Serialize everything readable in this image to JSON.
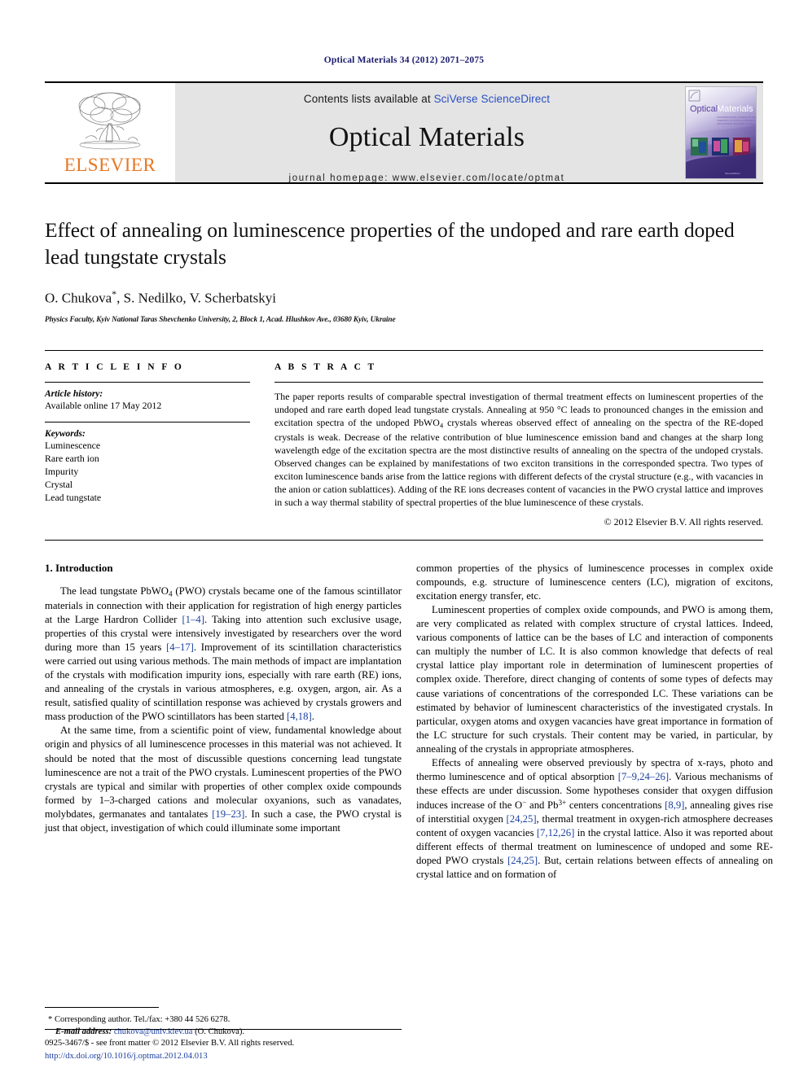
{
  "running_head": "Optical Materials 34 (2012) 2071–2075",
  "masthead": {
    "publisher_name": "ELSEVIER",
    "contents_prefix": "Contents lists available at ",
    "sciencedirect_link": "SciVerse ScienceDirect",
    "journal_title": "Optical Materials",
    "journal_homepage": "journal homepage: www.elsevier.com/locate/optmat",
    "cover_title_part1": "Optical",
    "cover_title_part2": "Materials",
    "cover_subtitle": "AN INTERNATIONAL JOURNAL ON THE PHYSICS AND CHEMISTRY OF OPTICAL MATERIALS AND THEIR APPLICATIONS"
  },
  "article": {
    "title": "Effect of annealing on luminescence properties of the undoped and rare earth doped lead tungstate crystals",
    "authors": "O. Chukova",
    "authors_rest": ", S. Nedilko, V. Scherbatskyi",
    "corresponding_marker": "*",
    "affiliation": "Physics Faculty, Kyiv National Taras Shevchenko University, 2, Block 1, Acad. Hlushkov Ave., 03680 Kyiv, Ukraine"
  },
  "article_info": {
    "heading": "A R T I C L E  I N F O",
    "history_label": "Article history:",
    "history_value": "Available online 17 May 2012",
    "keywords_label": "Keywords:",
    "keywords": [
      "Luminescence",
      "Rare earth ion",
      "Impurity",
      "Crystal",
      "Lead tungstate"
    ]
  },
  "abstract": {
    "heading": "A B S T R A C T",
    "paragraph_1": "The paper reports results of comparable spectral investigation of thermal treatment effects on luminescent properties of the undoped and rare earth doped lead tungstate crystals. Annealing at 950 °C leads to pronounced changes in the emission and excitation spectra of the undoped PbWO",
    "formula_sub_1": "4",
    "paragraph_1b": " crystals whereas observed effect of annealing on the spectra of the RE-doped crystals is weak. Decrease of the relative contribution of blue luminescence emission band and changes at the sharp long wavelength edge of the excitation spectra are the most distinctive results of annealing on the spectra of the undoped crystals. Observed changes can be explained by manifestations of two exciton transitions in the corresponded spectra. Two types of exciton luminescence bands arise from the lattice regions with different defects of the crystal structure (e.g., with vacancies in the anion or cation sublattices). Adding of the RE ions decreases content of vacancies in the PWO crystal lattice and improves in such a way thermal stability of spectral properties of the blue luminescence of these crystals.",
    "copyright": "© 2012 Elsevier B.V. All rights reserved."
  },
  "body": {
    "section_1_heading": "1. Introduction",
    "left_p1_a": "The lead tungstate PbWO",
    "left_p1_sub": "4",
    "left_p1_b": " (PWO) crystals became one of the famous scintillator materials in connection with their application for registration of high energy particles at the Large Hardron Collider ",
    "left_p1_ref1": "[1–4]",
    "left_p1_c": ". Taking into attention such exclusive usage, properties of this crystal were intensively investigated by researchers over the word during more than 15 years ",
    "left_p1_ref2": "[4–17]",
    "left_p1_d": ". Improvement of its scintillation characteristics were carried out using various methods. The main methods of impact are implantation of the crystals with modification impurity ions, especially with rare earth (RE) ions, and annealing of the crystals in various atmospheres, e.g. oxygen, argon, air. As a result, satisfied quality of scintillation response was achieved by crystals growers and mass production of the PWO scintillators has been started ",
    "left_p1_ref3": "[4,18]",
    "left_p1_e": ".",
    "left_p2_a": "At the same time, from a scientific point of view, fundamental knowledge about origin and physics of all luminescence processes in this material was not achieved. It should be noted that the most of discussible questions concerning lead tungstate luminescence are not a trait of the PWO crystals. Luminescent properties of the PWO crystals are typical and similar with properties of other complex oxide compounds formed by 1–3-charged cations and molecular oxyanions, such as vanadates, molybdates, germanates and tantalates ",
    "left_p2_ref1": "[19–23]",
    "left_p2_b": ". In such a case, the PWO crystal is just that object, investigation of which could illuminate some important",
    "right_p1": "common properties of the physics of luminescence processes in complex oxide compounds, e.g. structure of luminescence centers (LC), migration of excitons, excitation energy transfer, etc.",
    "right_p2": "Luminescent properties of complex oxide compounds, and PWO is among them, are very complicated as related with complex structure of crystal lattices. Indeed, various components of lattice can be the bases of LC and interaction of components can multiply the number of LC. It is also common knowledge that defects of real crystal lattice play important role in determination of luminescent properties of complex oxide. Therefore, direct changing of contents of some types of defects may cause variations of concentrations of the corresponded LC. These variations can be estimated by behavior of luminescent characteristics of the investigated crystals. In particular, oxygen atoms and oxygen vacancies have great importance in formation of the LC structure for such crystals. Their content may be varied, in particular, by annealing of the crystals in appropriate atmospheres.",
    "right_p3_a": "Effects of annealing were observed previously by spectra of x-rays, photo and thermo luminescence and of optical absorption ",
    "right_p3_ref1": "[7–9,24–26]",
    "right_p3_b": ". Various mechanisms of these effects are under discussion. Some hypotheses consider that oxygen diffusion induces increase of the O",
    "right_p3_sup1": "−",
    "right_p3_c": " and Pb",
    "right_p3_sup2": "3+",
    "right_p3_d": " centers concentrations ",
    "right_p3_ref2": "[8,9]",
    "right_p3_e": ", annealing gives rise of interstitial oxygen ",
    "right_p3_ref3": "[24,25]",
    "right_p3_f": ", thermal treatment in oxygen-rich atmosphere decreases content of oxygen vacancies ",
    "right_p3_ref4": "[7,12,26]",
    "right_p3_g": " in the crystal lattice. Also it was reported about different effects of thermal treatment on luminescence of undoped and some RE-doped PWO crystals ",
    "right_p3_ref5": "[24,25]",
    "right_p3_h": ". But, certain relations between effects of annealing on crystal lattice and on formation of"
  },
  "footnote": {
    "marker": "*",
    "corresponding_text": "Corresponding author. Tel./fax: +380 44 526 6278.",
    "email_label": "E-mail address:",
    "email": "chukova@univ.kiev.ua",
    "email_owner": "(O. Chukova)."
  },
  "footer": {
    "issn_line": "0925-3467/$ - see front matter © 2012 Elsevier B.V. All rights reserved.",
    "doi": "http://dx.doi.org/10.1016/j.optmat.2012.04.013"
  },
  "colors": {
    "elsevier_orange": "#e87722",
    "link_blue": "#1a3fa0",
    "masthead_gray": "#e4e4e4",
    "running_head_blue": "#1a1a6e"
  }
}
